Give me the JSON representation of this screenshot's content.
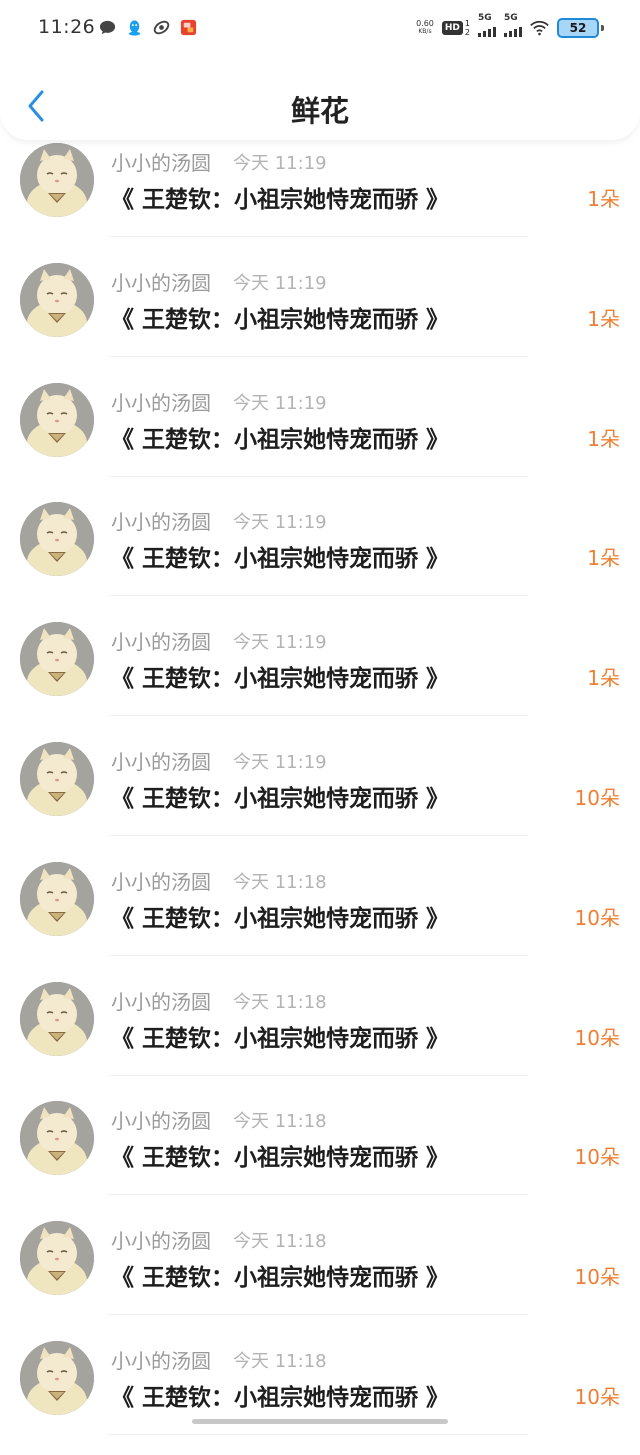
{
  "status_bar": {
    "time": "11:26",
    "net_speed_value": "0.60",
    "net_speed_unit": "KB/s",
    "hd_label": "HD",
    "sim1": "1",
    "sim2": "2",
    "signal1_label": "5G",
    "signal2_label": "5G",
    "battery": "52"
  },
  "header": {
    "title": "鲜花"
  },
  "colors": {
    "accent_blue": "#2b8fe0",
    "count_orange": "#ef7f34"
  },
  "items": [
    {
      "name": "小小的汤圆",
      "time": "今天 11:19",
      "book": "《 王楚钦：小祖宗她恃宠而骄 》",
      "count": "1朵"
    },
    {
      "name": "小小的汤圆",
      "time": "今天 11:19",
      "book": "《 王楚钦：小祖宗她恃宠而骄 》",
      "count": "1朵"
    },
    {
      "name": "小小的汤圆",
      "time": "今天 11:19",
      "book": "《 王楚钦：小祖宗她恃宠而骄 》",
      "count": "1朵"
    },
    {
      "name": "小小的汤圆",
      "time": "今天 11:19",
      "book": "《 王楚钦：小祖宗她恃宠而骄 》",
      "count": "1朵"
    },
    {
      "name": "小小的汤圆",
      "time": "今天 11:19",
      "book": "《 王楚钦：小祖宗她恃宠而骄 》",
      "count": "1朵"
    },
    {
      "name": "小小的汤圆",
      "time": "今天 11:19",
      "book": "《 王楚钦：小祖宗她恃宠而骄 》",
      "count": "10朵"
    },
    {
      "name": "小小的汤圆",
      "time": "今天 11:18",
      "book": "《 王楚钦：小祖宗她恃宠而骄 》",
      "count": "10朵"
    },
    {
      "name": "小小的汤圆",
      "time": "今天 11:18",
      "book": "《 王楚钦：小祖宗她恃宠而骄 》",
      "count": "10朵"
    },
    {
      "name": "小小的汤圆",
      "time": "今天 11:18",
      "book": "《 王楚钦：小祖宗她恃宠而骄 》",
      "count": "10朵"
    },
    {
      "name": "小小的汤圆",
      "time": "今天 11:18",
      "book": "《 王楚钦：小祖宗她恃宠而骄 》",
      "count": "10朵"
    },
    {
      "name": "小小的汤圆",
      "time": "今天 11:18",
      "book": "《 王楚钦：小祖宗她恃宠而骄 》",
      "count": "10朵"
    }
  ]
}
